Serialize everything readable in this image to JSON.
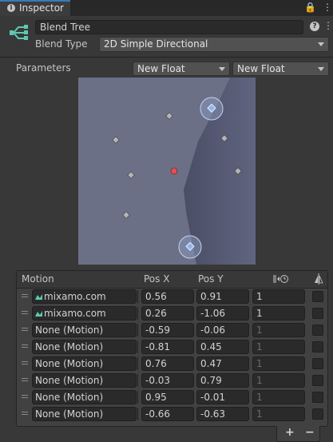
{
  "window": {
    "tab_label": "Inspector",
    "tab_icon": "info-icon",
    "lock_glyph": "🔒",
    "menu_glyph": "⋮"
  },
  "header": {
    "name_value": "Blend Tree",
    "help_glyph": "?",
    "menu_glyph": "⋮",
    "blend_type_label": "Blend Type",
    "blend_type_value": "2D Simple Directional"
  },
  "parameters": {
    "label": "Parameters",
    "param_x": "New Float",
    "param_y": "New Float"
  },
  "graph": {
    "background": "#6b7087",
    "dark_region": "#505470",
    "node_color": "#b4b4b4",
    "selected_node_color": "#d9dee9",
    "current_point_color": "#e05050"
  },
  "table": {
    "headers": {
      "motion": "Motion",
      "pos_x": "Pos X",
      "pos_y": "Pos Y"
    },
    "rows": [
      {
        "motion": "mixamo.com",
        "has_clip": true,
        "pos_x": "0.56",
        "pos_y": "0.91",
        "speed": "1",
        "speed_active": true
      },
      {
        "motion": "mixamo.com",
        "has_clip": true,
        "pos_x": "0.26",
        "pos_y": "-1.06",
        "speed": "1",
        "speed_active": true
      },
      {
        "motion": "None (Motion)",
        "has_clip": false,
        "pos_x": "-0.59",
        "pos_y": "-0.06",
        "speed": "1",
        "speed_active": false
      },
      {
        "motion": "None (Motion)",
        "has_clip": false,
        "pos_x": "-0.81",
        "pos_y": "0.45",
        "speed": "1",
        "speed_active": false
      },
      {
        "motion": "None (Motion)",
        "has_clip": false,
        "pos_x": "0.76",
        "pos_y": "0.47",
        "speed": "1",
        "speed_active": false
      },
      {
        "motion": "None (Motion)",
        "has_clip": false,
        "pos_x": "-0.03",
        "pos_y": "0.79",
        "speed": "1",
        "speed_active": false
      },
      {
        "motion": "None (Motion)",
        "has_clip": false,
        "pos_x": "0.95",
        "pos_y": "-0.01",
        "speed": "1",
        "speed_active": false
      },
      {
        "motion": "None (Motion)",
        "has_clip": false,
        "pos_x": "-0.66",
        "pos_y": "-0.63",
        "speed": "1",
        "speed_active": false
      }
    ],
    "add_glyph": "+",
    "remove_glyph": "−"
  }
}
